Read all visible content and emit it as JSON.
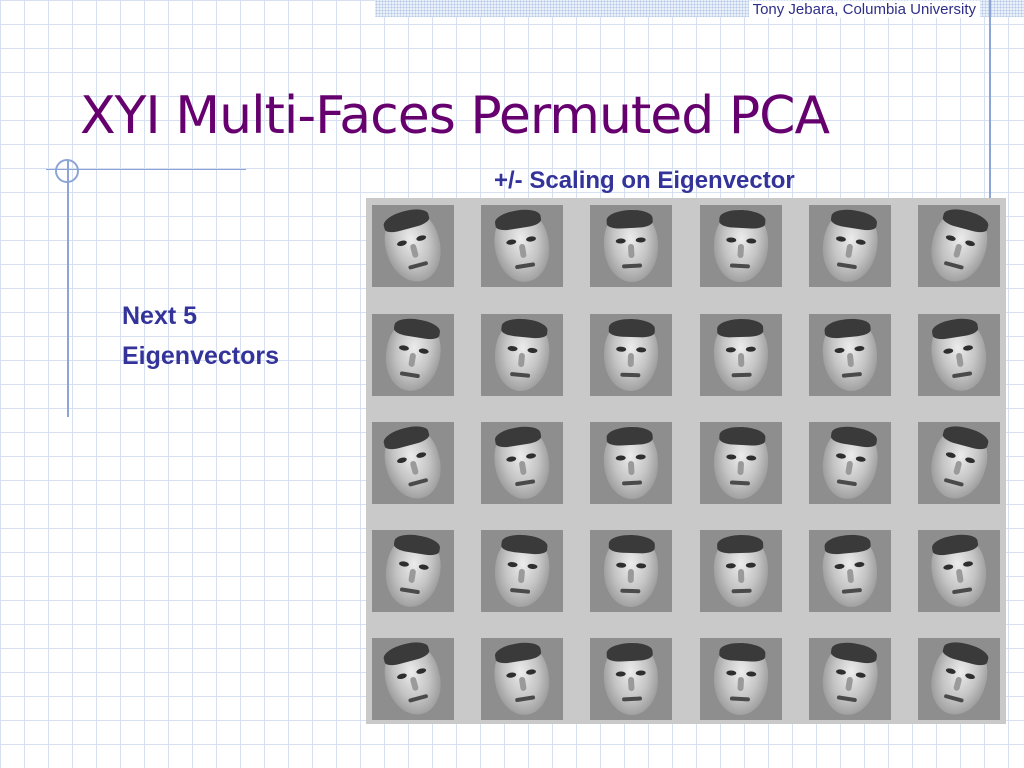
{
  "author": "Tony Jebara, Columbia University",
  "title": "XYI Multi-Faces Permuted PCA",
  "subtitle": "+/- Scaling on Eigenvector",
  "bullet": "Next 5\nEigenvectors",
  "colors": {
    "title": "#66006e",
    "body_text": "#33339a",
    "grid_lines": "#d6e0f0",
    "accent_lines": "#8da4d6",
    "panel_background": "#c9c9c9"
  },
  "face_grid": {
    "rows": 5,
    "columns": 6
  }
}
